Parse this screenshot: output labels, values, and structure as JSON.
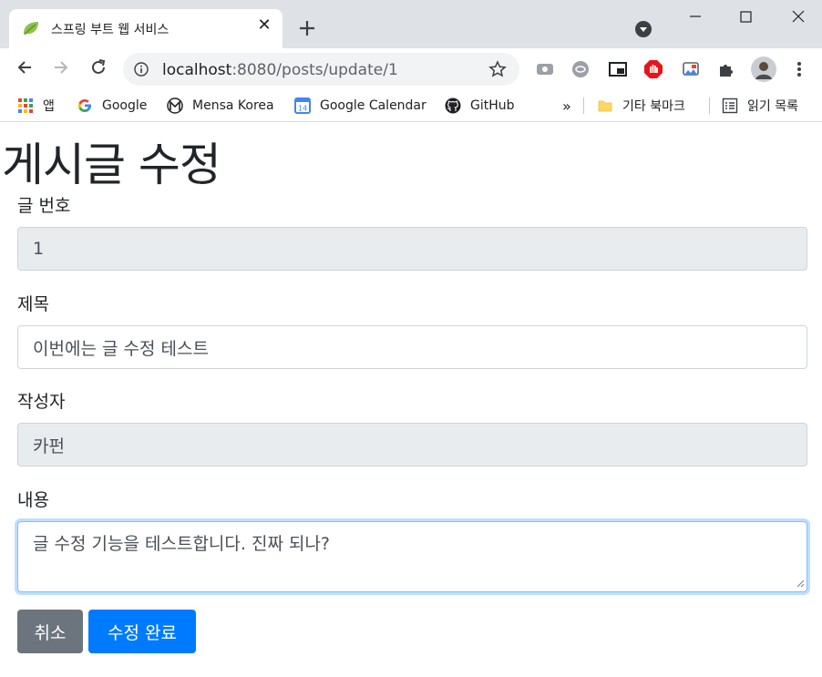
{
  "browser": {
    "tab_title": "스프링 부트 웹 서비스",
    "tab_close": "✕",
    "url_host": "localhost",
    "url_rest": ":8080/posts/update/1",
    "bookmarks": [
      {
        "label": "앱",
        "icon": "apps-grid-icon"
      },
      {
        "label": "Google",
        "icon": "google-icon"
      },
      {
        "label": "Mensa Korea",
        "icon": "mensa-icon"
      },
      {
        "label": "Google Calendar",
        "icon": "calendar-icon",
        "badge": "14"
      },
      {
        "label": "GitHub",
        "icon": "github-icon"
      }
    ],
    "overflow": "»",
    "other_bookmarks": "기타 북마크",
    "reading_list": "읽기 목록"
  },
  "page": {
    "title": "게시글 수정",
    "fields": {
      "id": {
        "label": "글 번호",
        "value": "1"
      },
      "title": {
        "label": "제목",
        "value": "이번에는 글 수정 테스트"
      },
      "author": {
        "label": "작성자",
        "value": "카펀"
      },
      "content": {
        "label": "내용",
        "value": "글 수정 기능을 테스트합니다. 진짜 되나?"
      }
    },
    "buttons": {
      "cancel": "취소",
      "submit": "수정 완료"
    }
  },
  "colors": {
    "primary": "#007bff",
    "secondary": "#6c757d",
    "readonly_bg": "#e9ecef",
    "focus_border": "#80bdff"
  }
}
